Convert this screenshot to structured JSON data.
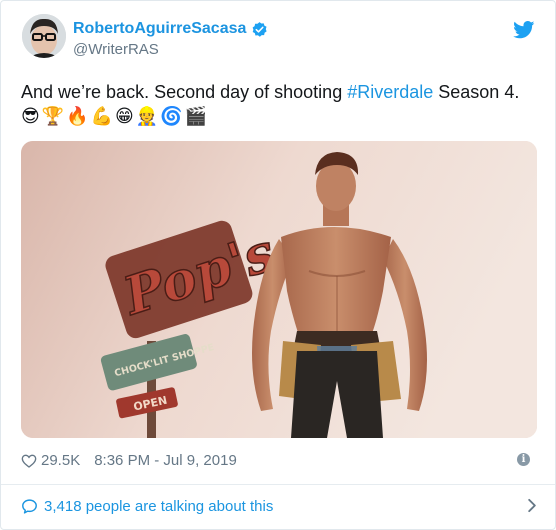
{
  "tweet": {
    "display_name": "RobertoAguirreSacasa",
    "handle": "@WriterRAS",
    "text_before": "And we’re back. Second day of shooting ",
    "hashtag": "#Riverdale",
    "text_after": " Season 4.",
    "emojis": [
      "😎",
      "🏆",
      "🔥",
      "💪",
      "😁",
      "👷",
      "🌀",
      "🎬"
    ],
    "likes": "29.5K",
    "timestamp": "8:36 PM - Jul 9, 2019",
    "talking": "3,418 people are talking about this",
    "info_glyph": "i"
  },
  "photo": {
    "sign_script": "Pop's",
    "sign_sub": "CHOCK'LIT SHOPPE",
    "sign_bottom": "OPEN"
  },
  "colors": {
    "accent": "#1b95e0",
    "secondary_text": "#657786",
    "divider": "#e6ecf0"
  },
  "icons": [
    "verified-icon",
    "twitter-bird-icon",
    "heart-icon",
    "info-icon",
    "speech-bubble-icon",
    "chevron-right-icon"
  ]
}
